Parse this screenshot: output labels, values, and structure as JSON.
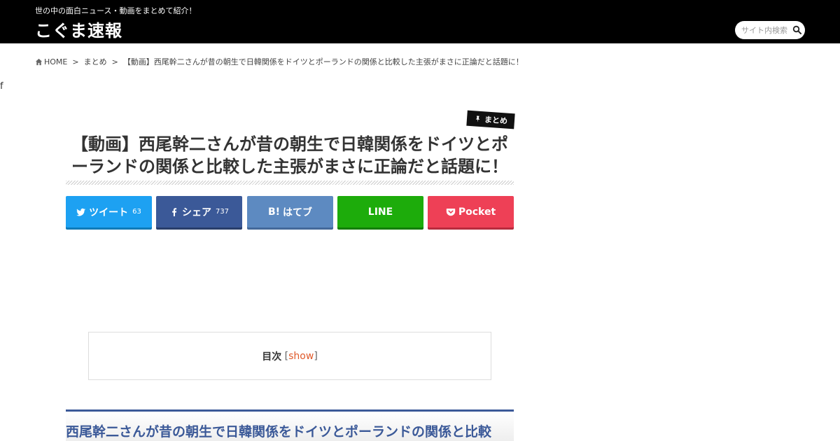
{
  "header": {
    "tagline": "世の中の面白ニュース・動画をまとめて紹介！",
    "site_title": "こぐま速報",
    "search_placeholder": "サイト内検索"
  },
  "breadcrumb": {
    "home": "HOME",
    "category": "まとめ",
    "current": "【動画】西尾幹二さんが昔の朝生で日韓関係をドイツとポーランドの関係と比較した主張がまさに正論だと話題に！",
    "separator": ">"
  },
  "stray_text": "f",
  "post": {
    "category": "まとめ",
    "title": "【動画】西尾幹二さんが昔の朝生で日韓関係をドイツとポーランドの関係と比較した主張がまさに正論だと話題に！"
  },
  "share": {
    "twitter_label": "ツイート",
    "twitter_count": "63",
    "facebook_label": "シェア",
    "facebook_count": "737",
    "hatena_label": "はてブ",
    "line_label": "LINE",
    "pocket_label": "Pocket"
  },
  "toc": {
    "title": "目次",
    "toggle": "show"
  },
  "section": {
    "heading": "西尾幹二さんが昔の朝生で日韓関係をドイツとポーランドの関係と比較"
  },
  "colors": {
    "header_bg": "#000000",
    "twitter": "#1da1f2",
    "facebook": "#3b5998",
    "hatena": "#5d8ac1",
    "line": "#1dac0b",
    "pocket": "#ee4056",
    "accent": "#e05a2b"
  }
}
